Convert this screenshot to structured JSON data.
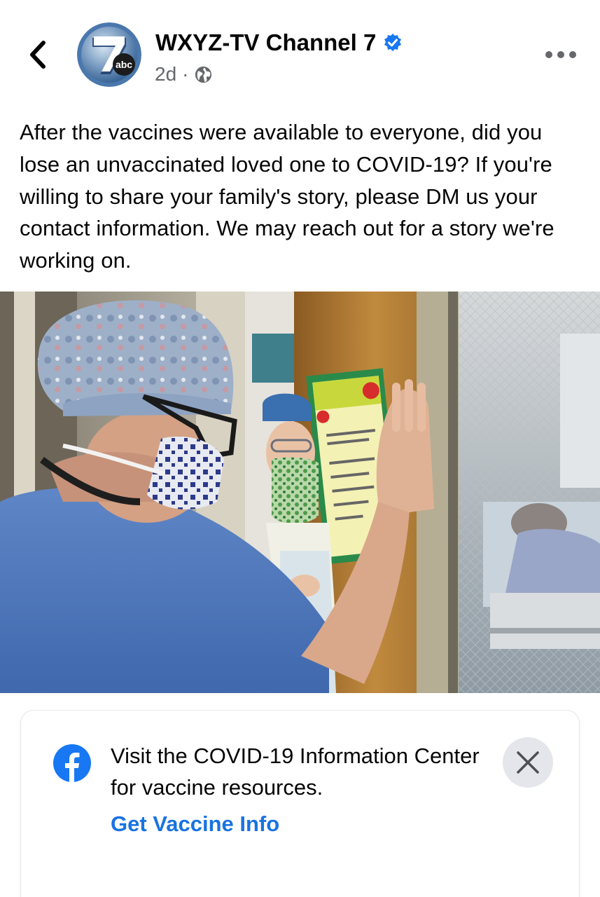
{
  "header": {
    "page_name": "WXYZ-TV Channel 7",
    "timestamp": "2d",
    "separator": "·",
    "avatar_logo_text": "abc",
    "verified_color": "#1877f2",
    "icons": [
      "back-chevron-icon",
      "verified-badge-icon",
      "globe-icon",
      "more-options-icon"
    ]
  },
  "post": {
    "text": "After the vaccines were available to everyone, did you lose an unvaccinated loved one to COVID-19? If you're willing to share your family's story, please DM us your contact information. We may reach out for a story we're working on.",
    "photo_description_icon": "hospital-photo"
  },
  "info_card": {
    "message": "Visit the COVID-19 Information Center for vaccine resources.",
    "link_label": "Get Vaccine Info",
    "link_color": "#1a73e0",
    "icon": "facebook-logo-icon",
    "close_icon": "close-icon"
  }
}
